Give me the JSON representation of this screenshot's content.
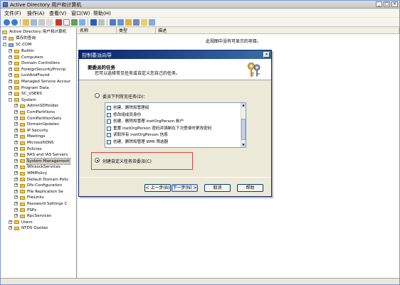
{
  "window": {
    "title": "Active Directory 用户和计算机",
    "min": "_",
    "max": "□",
    "close": "×"
  },
  "menu": [
    "文件(F)",
    "操作(A)",
    "查看(V)",
    "窗口(W)",
    "帮助(H)"
  ],
  "tree": {
    "root": "Active Directory 用户和计算机",
    "saved_queries": "保存的查询",
    "domain": "SC.COM",
    "items": [
      "Builtin",
      "Computers",
      "Domain Controllers",
      "ForeignSecurityPrincip",
      "LostAndFound",
      "Managed Service Accour",
      "Program Data",
      "SC_USERS",
      "System"
    ],
    "system_children": [
      "AdminSDHolder",
      "ComPartitions",
      "ComPartitionSets",
      "DomainUpdates",
      "IP Security",
      "Meetings",
      "MicrosoftDNS",
      "Policies",
      "RAS and IAS Servers",
      "System Management",
      "WinsockServices",
      "WMIPolicy",
      "Default Domain Polic",
      "Dfs-Configuration",
      "File Replication Se",
      "FileLinks",
      "Password Settings C",
      "PSPs",
      "RpcServices"
    ],
    "tail_items": [
      "Users",
      "NTDS Quotas"
    ]
  },
  "columns": [
    "名称",
    "类型",
    "描述"
  ],
  "empty_message": "此视图中没有可显示的项目。",
  "dialog": {
    "title": "控制委派向导",
    "close": "×",
    "header_title": "要委派的任务",
    "header_subtitle": "您可以选择常见任务或自定义您自己的任务。",
    "option_common": "委派下列常见任务(D)：",
    "tasks": [
      "创建、删除和管理组",
      "修改组成员身份",
      "创建、删除和管理 inetOrgPerson 帐户",
      "重置 inetOrgPerson 密码并强制在下次登录时更改密码",
      "读取所有 inetOrgPerson 信息",
      "创建、删除和管理 WMI 筛选器"
    ],
    "option_custom": "创建自定义任务去委派(C)",
    "buttons": {
      "back": "< 上一步(B)",
      "next": "下一步(N) >",
      "cancel": "取消",
      "help": "帮助"
    }
  }
}
